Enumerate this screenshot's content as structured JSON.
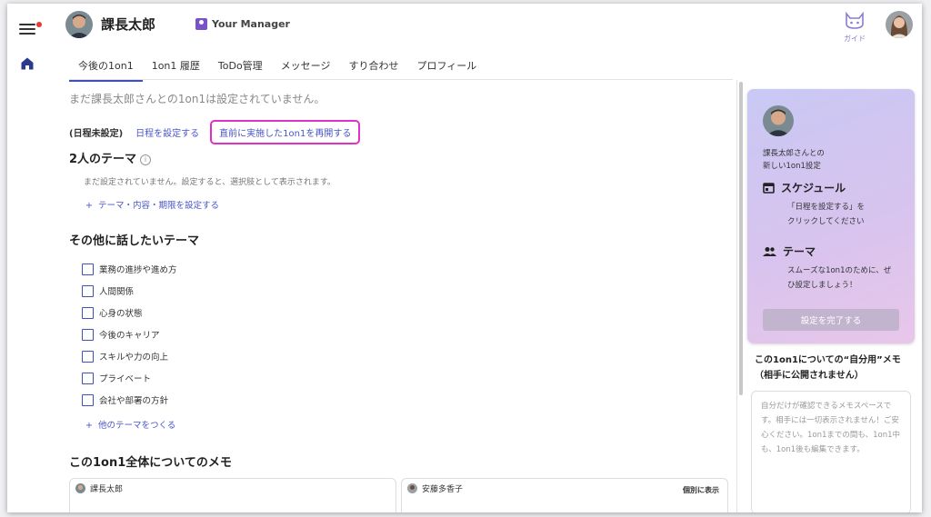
{
  "header": {
    "user_name": "課長太郎",
    "role": "Your Manager",
    "guide_label": "ガイド"
  },
  "tabs": [
    {
      "label": "今後の1on1"
    },
    {
      "label": "1on1 履歴"
    },
    {
      "label": "ToDo管理"
    },
    {
      "label": "メッセージ"
    },
    {
      "label": "すり合わせ"
    },
    {
      "label": "プロフィール"
    }
  ],
  "main": {
    "notice": "まだ課長太郎さんとの1on1は設定されていません。",
    "schedule_status": "(日程未設定)",
    "set_schedule_link": "日程を設定する",
    "resume_link": "直前に実施した1on1を再開する",
    "themes_title": "2人のテーマ",
    "themes_hint": "まだ設定されていません。設定すると、選択肢として表示されます。",
    "themes_add": "テーマ・内容・期限を設定する",
    "other_title": "その他に話したいテーマ",
    "other_items": [
      {
        "label": "業務の進捗や進め方"
      },
      {
        "label": "人間関係"
      },
      {
        "label": "心身の状態"
      },
      {
        "label": "今後のキャリア"
      },
      {
        "label": "スキルや力の向上"
      },
      {
        "label": "プライベート"
      },
      {
        "label": "会社や部署の方針"
      }
    ],
    "other_add": "他のテーマをつくる",
    "memo_title": "この1on1全体についてのメモ",
    "memo_left_name": "課長太郎",
    "memo_right_name": "安藤多香子",
    "individual_link": "個別に表示"
  },
  "side": {
    "card_line1": "課長太郎さんとの",
    "card_line2": "新しい1on1設定",
    "schedule_head": "スケジュール",
    "schedule_desc1": "「日程を設定する」を",
    "schedule_desc2": "クリックしてください",
    "theme_head": "テーマ",
    "theme_desc1": "スムーズな1on1のために、ぜ",
    "theme_desc2": "ひ設定しましょう！",
    "complete_button": "設定を完了する",
    "private_title": "この1on1についての“自分用”メモ（相手に公開されません）",
    "private_placeholder": "自分だけが確認できるメモスペースです。相手には一切表示されません！ご安心ください。1on1までの間も、1on1中も、1on1後も編集できます。"
  },
  "colors": {
    "accent": "#3f51b5",
    "link": "#4a56c8",
    "highlight_border": "#e030c8",
    "card_gradient_start": "#c9c8f4",
    "card_gradient_end": "#e8c6e9"
  },
  "icons": [
    "menu-icon",
    "home-icon",
    "info-icon",
    "calendar-icon",
    "people-icon",
    "guide-cat-icon"
  ]
}
